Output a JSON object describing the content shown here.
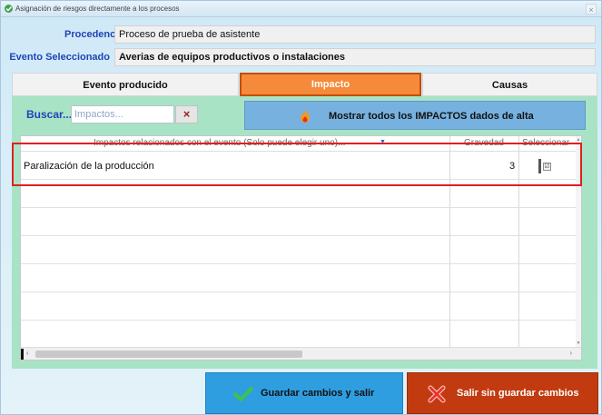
{
  "window": {
    "title": "Asignación de riesgos directamente a los procesos",
    "close_glyph": "×"
  },
  "fields": {
    "procedencia_label": "Procedencia",
    "procedencia_value": "Proceso de prueba de asistente",
    "evento_label": "Evento Seleccionado",
    "evento_value": "Averias de equipos productivos o instalaciones"
  },
  "tabs": [
    {
      "label": "Evento producido",
      "active": false
    },
    {
      "label": "Impacto",
      "active": true
    },
    {
      "label": "Causas",
      "active": false
    }
  ],
  "search": {
    "label": "Buscar...",
    "placeholder": "Impactos...",
    "clear_glyph": "×"
  },
  "show_all_button": {
    "label": "Mostrar todos los IMPACTOS dados de alta",
    "icon": "flame-icon"
  },
  "grid": {
    "columns": [
      {
        "header": "Impactos relacionados con el evento (Solo puede elegir uno)..."
      },
      {
        "header": "Gravedad"
      },
      {
        "header": "Seleccionar"
      }
    ],
    "sort_glyph": "▼",
    "rows": [
      {
        "impacto": "Paralización de la producción",
        "gravedad": "3",
        "seleccionar": "☑"
      }
    ],
    "scroll_left": "‹",
    "scroll_right": "›",
    "scroll_up": "▲",
    "scroll_down": "▼"
  },
  "footer": {
    "save_label": "Guardar cambios y salir",
    "exit_label": "Salir sin guardar cambios"
  },
  "colors": {
    "accent_blue": "#1f45b5",
    "active_tab": "#f58a3a",
    "panel_bg": "#a8e3c6",
    "save_button": "#2f9ee0",
    "exit_button": "#c23b10",
    "highlight": "#e02020"
  }
}
